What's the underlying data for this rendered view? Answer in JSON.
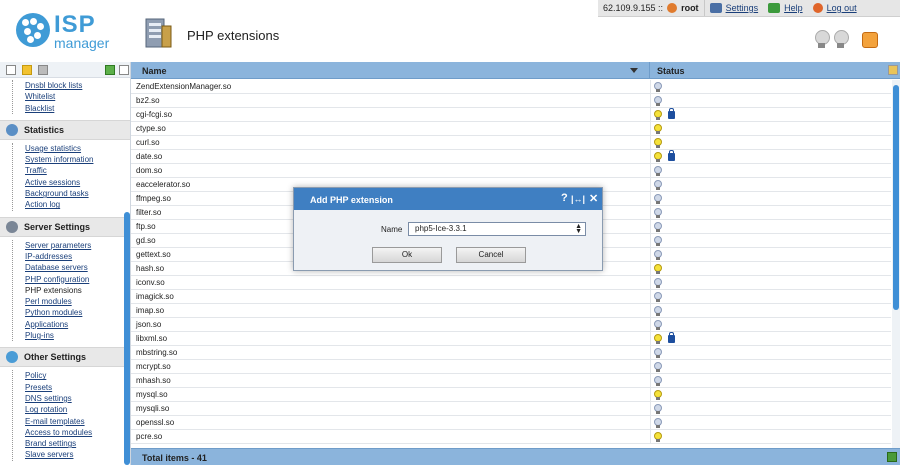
{
  "app": {
    "logo_text": "ISP",
    "logo_sub": "manager",
    "page_title": "PHP extensions"
  },
  "topbar": {
    "ip": "62.109.9.155 ::",
    "user": "root",
    "settings": "Settings",
    "help": "Help",
    "logout": "Log out"
  },
  "sidebar": {
    "top_items": [
      "Dnsbl block lists",
      "Whitelist",
      "Blacklist"
    ],
    "groups": [
      {
        "title": "Statistics",
        "items": [
          "Usage statistics",
          "System information",
          "Traffic",
          "Active sessions",
          "Background tasks",
          "Action log"
        ]
      },
      {
        "title": "Server Settings",
        "items": [
          "Server parameters",
          "IP-addresses",
          "Database servers",
          "PHP configuration",
          "PHP extensions",
          "Perl modules",
          "Python modules",
          "Applications",
          "Plug-ins"
        ]
      },
      {
        "title": "Other Settings",
        "items": [
          "Policy",
          "Presets",
          "DNS settings",
          "Log rotation",
          "E-mail templates",
          "Access to modules",
          "Brand settings",
          "Slave servers"
        ]
      }
    ]
  },
  "table": {
    "columns": [
      "Name",
      "Status"
    ],
    "rows": [
      {
        "name": "ZendExtensionManager.so",
        "on": false,
        "lock": false
      },
      {
        "name": "bz2.so",
        "on": false,
        "lock": false
      },
      {
        "name": "cgi-fcgi.so",
        "on": true,
        "lock": true
      },
      {
        "name": "ctype.so",
        "on": true,
        "lock": false
      },
      {
        "name": "curl.so",
        "on": true,
        "lock": false
      },
      {
        "name": "date.so",
        "on": true,
        "lock": true
      },
      {
        "name": "dom.so",
        "on": false,
        "lock": false
      },
      {
        "name": "eaccelerator.so",
        "on": false,
        "lock": false
      },
      {
        "name": "ffmpeg.so",
        "on": false,
        "lock": false
      },
      {
        "name": "filter.so",
        "on": false,
        "lock": false
      },
      {
        "name": "ftp.so",
        "on": false,
        "lock": false
      },
      {
        "name": "gd.so",
        "on": false,
        "lock": false
      },
      {
        "name": "gettext.so",
        "on": false,
        "lock": false
      },
      {
        "name": "hash.so",
        "on": true,
        "lock": false
      },
      {
        "name": "iconv.so",
        "on": false,
        "lock": false
      },
      {
        "name": "imagick.so",
        "on": false,
        "lock": false
      },
      {
        "name": "imap.so",
        "on": false,
        "lock": false
      },
      {
        "name": "json.so",
        "on": false,
        "lock": false
      },
      {
        "name": "libxml.so",
        "on": true,
        "lock": true
      },
      {
        "name": "mbstring.so",
        "on": false,
        "lock": false
      },
      {
        "name": "mcrypt.so",
        "on": false,
        "lock": false
      },
      {
        "name": "mhash.so",
        "on": false,
        "lock": false
      },
      {
        "name": "mysql.so",
        "on": true,
        "lock": false
      },
      {
        "name": "mysqli.so",
        "on": false,
        "lock": false
      },
      {
        "name": "openssl.so",
        "on": false,
        "lock": false
      },
      {
        "name": "pcre.so",
        "on": true,
        "lock": false
      }
    ],
    "footer": "Total items - 41"
  },
  "dialog": {
    "title": "Add PHP extension",
    "name_label": "Name",
    "name_value": "php5-Ice-3.3.1",
    "ok": "Ok",
    "cancel": "Cancel",
    "help_glyph": "?",
    "max_glyph": "|↔|",
    "close_glyph": "✕"
  },
  "colors": {
    "accent": "#3f7fc2",
    "header_bar": "#8bb4dc",
    "bulb_on": "#f5e23a",
    "bulb_off": "#cfd8e8"
  }
}
